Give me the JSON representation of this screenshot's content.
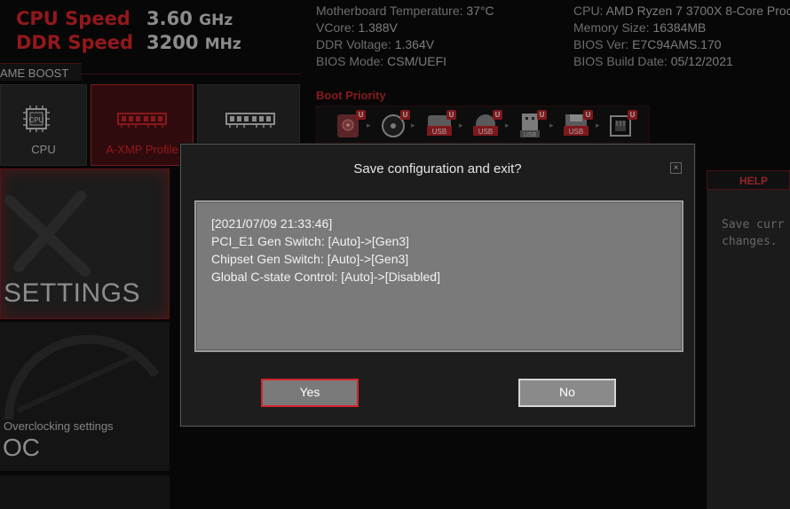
{
  "header": {
    "cpu_speed_label": "CPU Speed",
    "cpu_speed_value": "3.60",
    "cpu_speed_unit": "GHz",
    "ddr_speed_label": "DDR Speed",
    "ddr_speed_value": "3200",
    "ddr_speed_unit": "MHz"
  },
  "sysinfo_left": [
    {
      "label": "Motherboard Temperature: ",
      "value": "37°C"
    },
    {
      "label": "VCore: ",
      "value": "1.388V"
    },
    {
      "label": "DDR Voltage: ",
      "value": "1.364V"
    },
    {
      "label": "BIOS Mode: ",
      "value": "CSM/UEFI"
    }
  ],
  "sysinfo_right": [
    {
      "label": "CPU: ",
      "value": "AMD Ryzen 7 3700X 8-Core Proc"
    },
    {
      "label": "Memory Size: ",
      "value": "16384MB"
    },
    {
      "label": "BIOS Ver: ",
      "value": "E7C94AMS.170"
    },
    {
      "label": "BIOS Build Date: ",
      "value": "05/12/2021"
    }
  ],
  "game_boost": {
    "label": "AME BOOST",
    "tiles": [
      {
        "label": "CPU",
        "icon": "cpu-chip-icon"
      },
      {
        "label": "A-XMP Profile",
        "icon": "memory-module-red-icon"
      },
      {
        "label": "",
        "icon": "memory-module-icon"
      }
    ]
  },
  "boot_priority": {
    "title": "Boot Priority",
    "badge": "U",
    "devices": [
      {
        "icon": "hard-drive-icon",
        "text": ""
      },
      {
        "icon": "optical-disc-icon",
        "text": ""
      },
      {
        "icon": "usb-drive-icon",
        "text": "USB"
      },
      {
        "icon": "usb-disc-icon",
        "text": "USB"
      },
      {
        "icon": "usb-key-icon",
        "text": "USB"
      },
      {
        "icon": "usb-floppy-icon",
        "text": "USB"
      },
      {
        "icon": "network-icon",
        "text": ""
      }
    ]
  },
  "left_menu": {
    "settings_label": "SETTINGS",
    "oc_subtitle": "Overclocking settings",
    "oc_label": "OC"
  },
  "help": {
    "tab_label": "HELP",
    "text": "Save curr\nchanges."
  },
  "dialog": {
    "title": "Save configuration and exit?",
    "close_glyph": "×",
    "lines": [
      "[2021/07/09 21:33:46]",
      "PCI_E1 Gen Switch: [Auto]->[Gen3]",
      "Chipset Gen Switch: [Auto]->[Gen3]",
      "Global C-state Control: [Auto]->[Disabled]"
    ],
    "yes_label": "Yes",
    "no_label": "No"
  },
  "colors": {
    "accent_red": "#e0262c",
    "background": "#0b0b0b",
    "dialog_bg": "#1d1d1d",
    "changes_bg": "#7a7a7a"
  }
}
